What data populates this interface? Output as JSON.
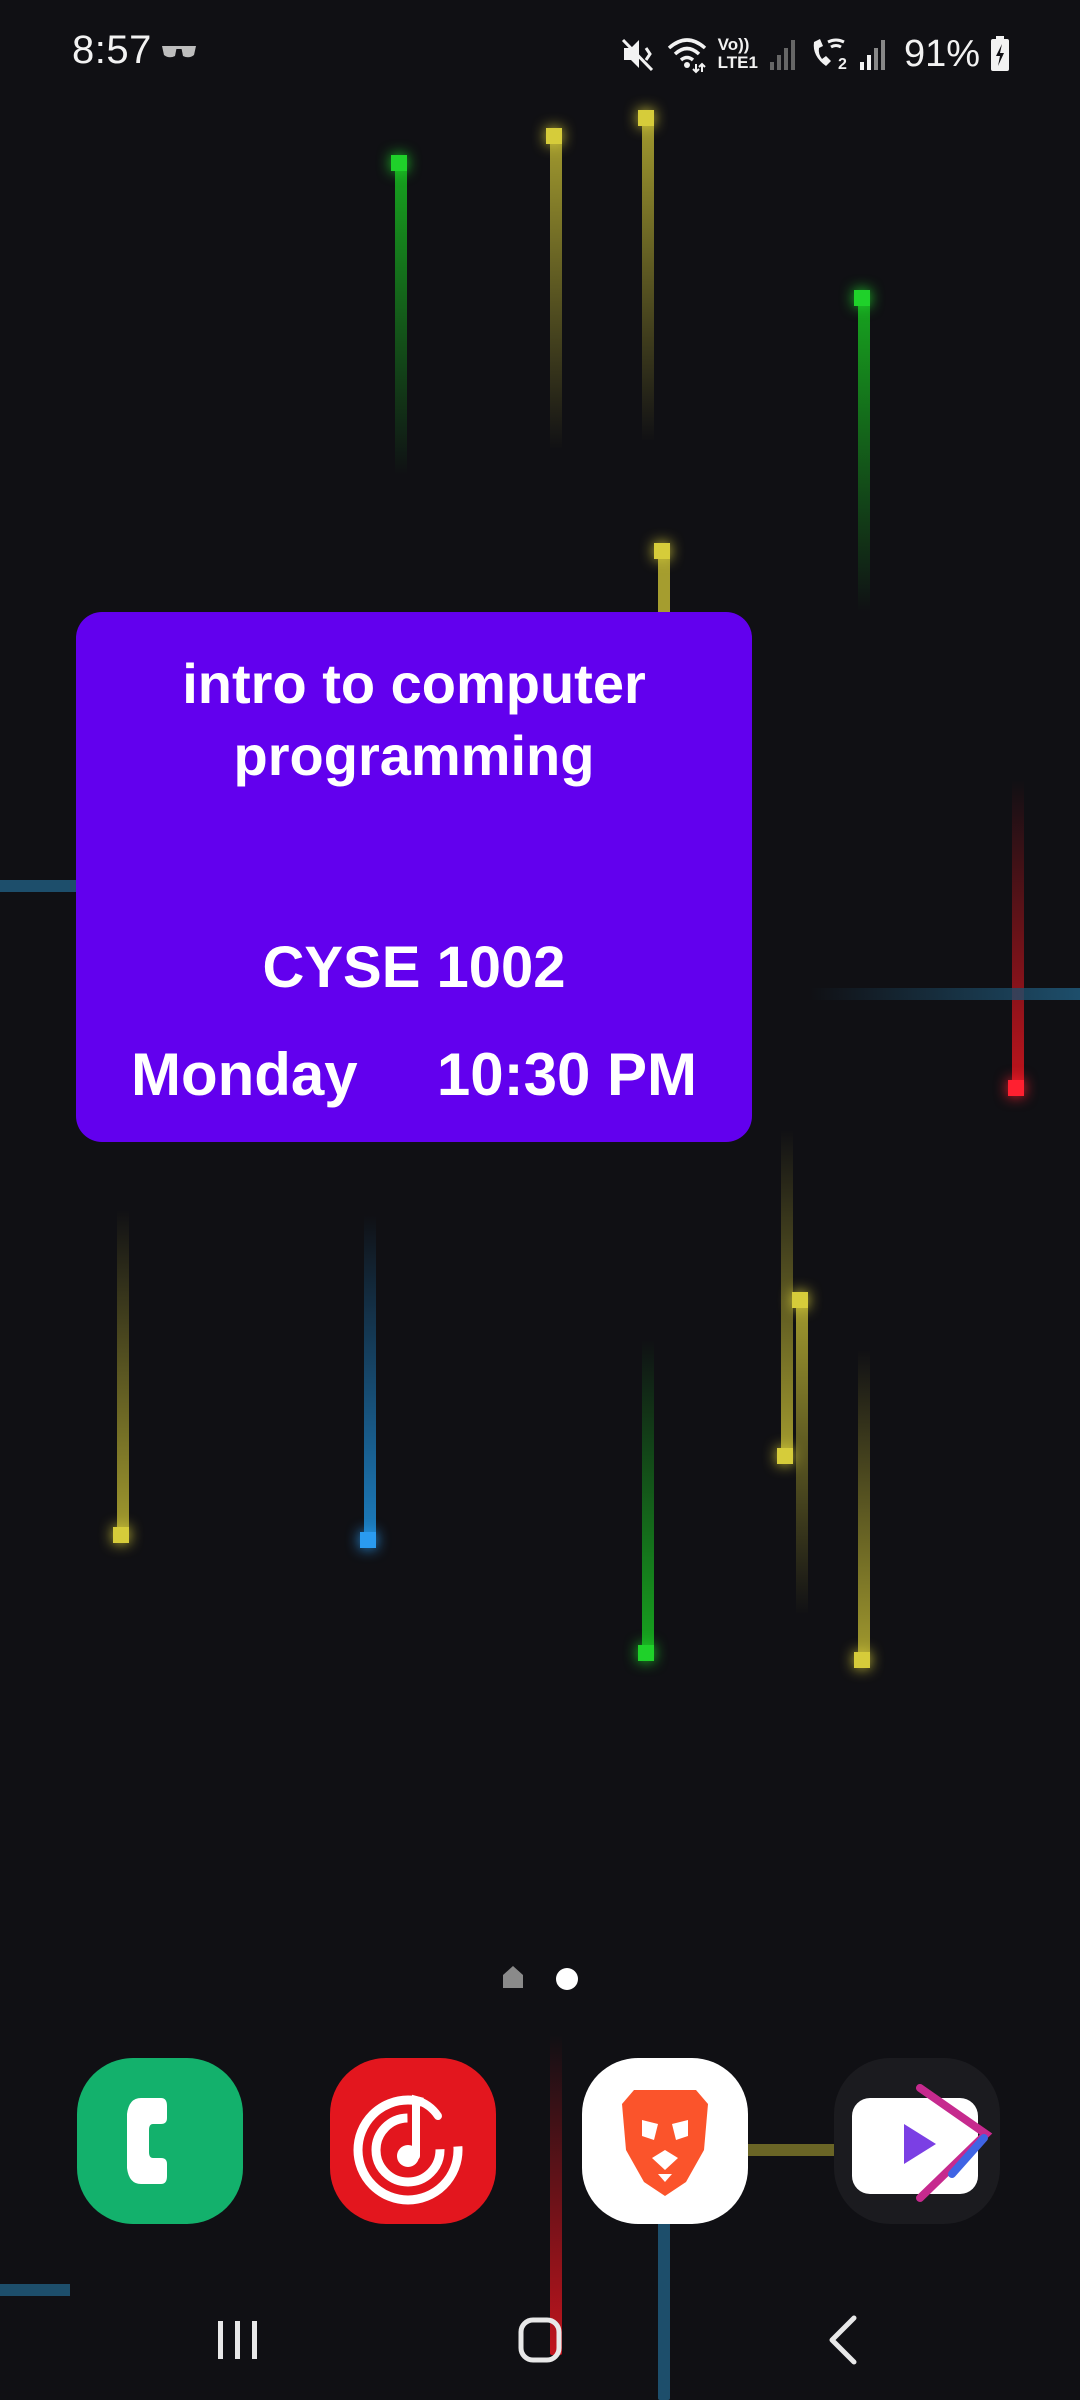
{
  "status_bar": {
    "time": "8:57",
    "battery_percent": "91%",
    "network_label_top": "Vo))",
    "network_label_bottom": "LTE1",
    "sim2_label": "2",
    "icons": [
      "glasses-icon",
      "mute-vibrate-icon",
      "wifi-icon",
      "volte-lte-icon",
      "signal-icon",
      "wifi-call-icon",
      "signal-icon",
      "battery-charging-icon"
    ]
  },
  "widget": {
    "title": "intro to computer programming",
    "course_code": "CYSE 1002",
    "day": "Monday",
    "time": "10:30 PM",
    "background_color": "#6200ee"
  },
  "page_indicator": {
    "pages": [
      "home",
      "page-2"
    ],
    "active_index": 1
  },
  "dock": {
    "apps": [
      {
        "icon": "phone-icon",
        "color": "#13b16c"
      },
      {
        "icon": "music-icon",
        "color": "#e3161e"
      },
      {
        "icon": "brave-lion-icon",
        "color": "#ffffff"
      },
      {
        "icon": "video-player-icon",
        "color": "#1b1b1f"
      }
    ]
  },
  "nav_bar": {
    "buttons": [
      "recents-icon",
      "home-icon",
      "back-icon"
    ]
  }
}
